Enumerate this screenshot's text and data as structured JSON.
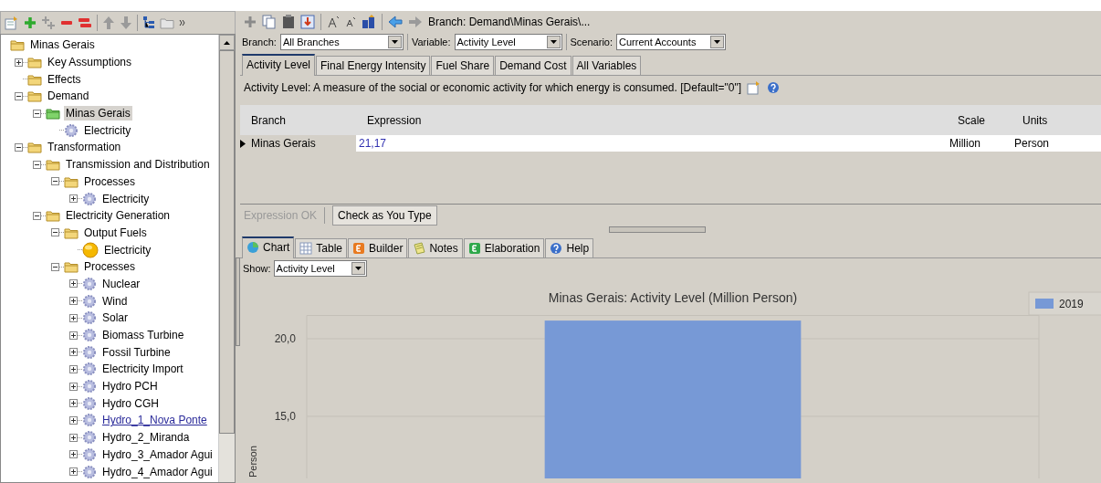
{
  "tree": {
    "items": [
      {
        "label": "Minas Gerais",
        "kind": "folder",
        "children": [
          {
            "label": "Key Assumptions",
            "kind": "folder",
            "expanded": false
          },
          {
            "label": "Effects",
            "kind": "folder"
          },
          {
            "label": "Demand",
            "kind": "folder",
            "expanded": true,
            "children": [
              {
                "label": "Minas Gerais",
                "kind": "folder",
                "selected": true,
                "expanded": true,
                "children": [
                  {
                    "label": "Electricity",
                    "kind": "gear"
                  }
                ]
              }
            ]
          },
          {
            "label": "Transformation",
            "kind": "folder",
            "expanded": true,
            "children": [
              {
                "label": "Transmission and Distribution",
                "kind": "folder",
                "expanded": true,
                "children": [
                  {
                    "label": "Processes",
                    "kind": "folder",
                    "expanded": true,
                    "children": [
                      {
                        "label": "Electricity",
                        "kind": "gear",
                        "expanded": false
                      }
                    ]
                  }
                ]
              },
              {
                "label": "Electricity Generation",
                "kind": "folder",
                "expanded": true,
                "children": [
                  {
                    "label": "Output Fuels",
                    "kind": "folder",
                    "expanded": true,
                    "children": [
                      {
                        "label": "Electricity",
                        "kind": "fuel"
                      }
                    ]
                  },
                  {
                    "label": "Processes",
                    "kind": "folder",
                    "expanded": true,
                    "children": [
                      {
                        "label": "Nuclear",
                        "kind": "gear",
                        "expanded": false
                      },
                      {
                        "label": "Wind",
                        "kind": "gear",
                        "expanded": false
                      },
                      {
                        "label": "Solar",
                        "kind": "gear",
                        "expanded": false
                      },
                      {
                        "label": "Biomass Turbine",
                        "kind": "gear",
                        "expanded": false
                      },
                      {
                        "label": "Fossil Turbine",
                        "kind": "gear",
                        "expanded": false
                      },
                      {
                        "label": "Electricity Import",
                        "kind": "gear",
                        "expanded": false
                      },
                      {
                        "label": "Hydro PCH",
                        "kind": "gear",
                        "expanded": false
                      },
                      {
                        "label": "Hydro CGH",
                        "kind": "gear",
                        "expanded": false
                      },
                      {
                        "label": "Hydro_1_Nova Ponte",
                        "kind": "gear",
                        "expanded": false,
                        "hovered": true
                      },
                      {
                        "label": "Hydro_2_Miranda",
                        "kind": "gear",
                        "expanded": false
                      },
                      {
                        "label": "Hydro_3_Amador Agui",
                        "kind": "gear",
                        "expanded": false
                      },
                      {
                        "label": "Hydro_4_Amador Agui",
                        "kind": "gear",
                        "expanded": false
                      }
                    ]
                  }
                ]
              }
            ]
          }
        ]
      }
    ]
  },
  "breadcrumb": "Branch: Demand\\Minas Gerais\\...",
  "filters": [
    {
      "label": "Branch:",
      "value": "All Branches"
    },
    {
      "label": "Variable:",
      "value": "Activity Level"
    },
    {
      "label": "Scenario:",
      "value": "Current Accounts"
    }
  ],
  "variable_tabs": [
    {
      "label": "Activity Level",
      "selected": true
    },
    {
      "label": "Final Energy Intensity",
      "selected": false
    },
    {
      "label": "Fuel Share",
      "selected": false
    },
    {
      "label": "Demand Cost",
      "selected": false
    },
    {
      "label": "All Variables",
      "selected": false
    }
  ],
  "description": "Activity Level: A measure of the social or economic activity for which energy is consumed. [Default=\"0\"]",
  "table": {
    "columns": [
      "Branch",
      "Expression",
      "Scale",
      "Units"
    ],
    "rows": [
      {
        "branch": "Minas Gerais",
        "expression": "21,17",
        "scale": "Million",
        "units": "Person",
        "current": true
      }
    ]
  },
  "status": {
    "message": "Expression OK",
    "check_button": "Check as You Type"
  },
  "view_tabs": [
    {
      "label": "Chart",
      "kind": "chart",
      "selected": true
    },
    {
      "label": "Table",
      "kind": "table",
      "selected": false
    },
    {
      "label": "Builder",
      "kind": "builder",
      "selected": false
    },
    {
      "label": "Notes",
      "kind": "notes",
      "selected": false
    },
    {
      "label": "Elaboration",
      "kind": "elaboration",
      "selected": false
    },
    {
      "label": "Help",
      "kind": "help",
      "selected": false
    }
  ],
  "show": {
    "label": "Show:",
    "value": "Activity Level"
  },
  "chart_data": {
    "type": "bar",
    "title": "Minas Gerais: Activity Level (Million Person)",
    "ylabel": "Person",
    "ylim": [
      0,
      21.5
    ],
    "yticks": [
      {
        "value": 15,
        "label": "15,0"
      },
      {
        "value": 20,
        "label": "20,0"
      }
    ],
    "series": [
      {
        "name": "2019",
        "color": "#7799d6",
        "values": [
          21.17
        ]
      }
    ]
  }
}
